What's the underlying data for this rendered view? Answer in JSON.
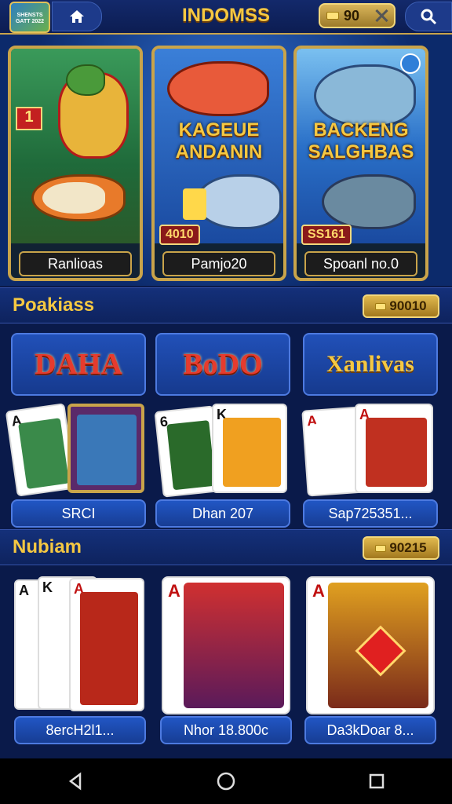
{
  "header": {
    "logo_text": "SHENSTS GATT 2022",
    "title": "INDOMSS",
    "coins": "90",
    "home_icon": "home-icon",
    "search_icon": "search-icon",
    "close_icon": "close-icon"
  },
  "hero": [
    {
      "label": "Ranlioas",
      "art_text": "",
      "num": "1"
    },
    {
      "label": "Pamjo20",
      "art_text": "KAGEUE ANDANIN",
      "badge": "4010"
    },
    {
      "label": "Spoanl no.0",
      "art_text": "BACKENG SALGHBAS",
      "badge": "SS161"
    }
  ],
  "section1": {
    "title": "Poakiass",
    "coins": "90010",
    "tiles": [
      {
        "banner": "DAHA",
        "caption": "SRCI"
      },
      {
        "banner": "BoDO",
        "caption": "Dhan 207"
      },
      {
        "banner": "Xanlivas",
        "caption": "Sap725351..."
      }
    ]
  },
  "section2": {
    "title": "Nubiam",
    "coins": "90215",
    "tiles": [
      {
        "caption": "8ercH2l1..."
      },
      {
        "caption": "Nhor 18.800c"
      },
      {
        "caption": "Da3kDoar 8..."
      }
    ]
  },
  "navbar": {
    "back_icon": "back-icon",
    "home_icon": "home-circle-icon",
    "recents_icon": "recents-icon"
  },
  "colors": {
    "gold": "#f5c842",
    "background": "#0a1a4a",
    "card_blue": "#2156c4"
  }
}
